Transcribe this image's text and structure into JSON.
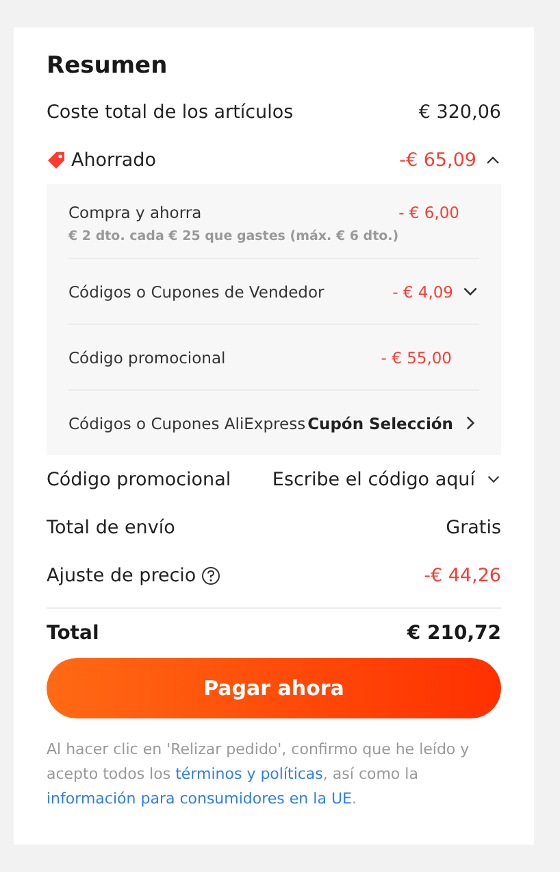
{
  "summary": {
    "title": "Resumen",
    "items_cost": {
      "label": "Coste total de los artículos",
      "value": "€ 320,06"
    },
    "savings": {
      "label": "Ahorrado",
      "value": "-€ 65,09",
      "expanded": true,
      "details": [
        {
          "kind": "discount",
          "label": "Compra y ahorra",
          "note": "€ 2 dto. cada € 25 que gastes (máx. € 6 dto.)",
          "value": "- € 6,00"
        },
        {
          "kind": "discount",
          "label": "Códigos o Cupones de Vendedor",
          "value": "- € 4,09",
          "dropdown": true
        },
        {
          "kind": "discount",
          "label": "Código promocional",
          "value": "- € 55,00"
        },
        {
          "kind": "coupon",
          "label": "Códigos o Cupones AliExpress",
          "value": "Cupón Selección",
          "opens_page": true
        }
      ]
    },
    "promo": {
      "label": "Código promocional",
      "placeholder": "Escribe el código aquí"
    },
    "shipping": {
      "label": "Total de envío",
      "value": "Gratis"
    },
    "adjustment": {
      "label": "Ajuste de precio",
      "value": "-€ 44,26"
    },
    "total": {
      "label": "Total",
      "value": "€ 210,72"
    },
    "pay_button": "Pagar ahora",
    "legal": [
      {
        "kind": "text",
        "text": "Al hacer clic en 'Relizar pedido', confirmo que he leído y acepto todos los "
      },
      {
        "kind": "link",
        "text": "términos y políticas"
      },
      {
        "kind": "text",
        "text": ", así como la "
      },
      {
        "kind": "link",
        "text": "información para consumidores en la UE"
      },
      {
        "kind": "text",
        "text": "."
      }
    ]
  }
}
